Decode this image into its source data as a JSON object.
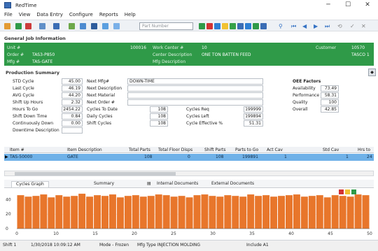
{
  "window": {
    "title": "RedTime"
  },
  "menu": [
    "File",
    "View",
    "Data Entry",
    "Configure",
    "Reports",
    "Help"
  ],
  "toolbar": {
    "part_placeholder": "Part Number"
  },
  "general": {
    "header": "General Job Information",
    "cells": [
      {
        "label": "Unit #",
        "value": "100016"
      },
      {
        "label": "Work Center #",
        "value": "10"
      },
      {
        "label": "Customer",
        "value": "10570"
      },
      {
        "label": "Order #",
        "value": "TAS3-P850"
      },
      {
        "label": "Center Description",
        "value": "ONE TON BATTEN FEED"
      },
      {
        "label": "",
        "value": "TASCO 1"
      },
      {
        "label": "Mfg #",
        "value": "TAS-GATE"
      },
      {
        "label": "Mfg Description",
        "value": ""
      }
    ]
  },
  "summary": {
    "header": "Production Summary",
    "left": [
      {
        "label": "STD Cycle",
        "value": "45.00"
      },
      {
        "label": "Last Cycle",
        "value": "46.19"
      },
      {
        "label": "AVG Cycle",
        "value": "44.20"
      },
      {
        "label": "Shift Up Hours",
        "value": "2.32"
      },
      {
        "label": "Hours To Go",
        "value": "2454.22"
      },
      {
        "label": "Shift Down Time",
        "value": "0.84"
      },
      {
        "label": "Continuously Down",
        "value": "0.00"
      },
      {
        "label": "Downtime Description",
        "value": ""
      }
    ],
    "next": [
      {
        "label": "Next Mfg#",
        "value": "DOWN-TIME"
      },
      {
        "label": "Next Description",
        "value": ""
      },
      {
        "label": "Next Material",
        "value": ""
      },
      {
        "label": "Next Order #",
        "value": ""
      }
    ],
    "cycles": [
      {
        "label": "Cycles To Date",
        "value": "108"
      },
      {
        "label": "Daily Cycles",
        "value": "108"
      },
      {
        "label": "Shift Cycles",
        "value": "108"
      }
    ],
    "req": [
      {
        "label": "Cycles Req",
        "value": "199999"
      },
      {
        "label": "Cycles Left",
        "value": "199894"
      },
      {
        "label": "Cycle Effective %",
        "value": "51.31"
      }
    ],
    "oee": {
      "header": "OEE Factors",
      "rows": [
        {
          "label": "Availability",
          "value": "73.49"
        },
        {
          "label": "Performance",
          "value": "58.31"
        },
        {
          "label": "Quality",
          "value": "100"
        },
        {
          "label": "Overall",
          "value": "42.85"
        }
      ]
    }
  },
  "grid": {
    "headers": [
      "Item #",
      "Item Description",
      "Total Parts",
      "Total Floor Disps",
      "Shift Parts",
      "Parts to Go",
      "Act Cav",
      "Std Cav",
      "Hrs to"
    ],
    "row": [
      "TAS-50000",
      "GATE",
      "108",
      "0",
      "108",
      "199891",
      "1",
      "1",
      "24"
    ]
  },
  "tabs": [
    "Cycles Graph",
    "Summary",
    "Internal Documents",
    "External Documents"
  ],
  "chart_data": {
    "type": "bar",
    "values": [
      46,
      44,
      45,
      47,
      43,
      46,
      44,
      45,
      48,
      44,
      46,
      45,
      47,
      43,
      45,
      46,
      44,
      45,
      47,
      46,
      44,
      45,
      43,
      46,
      47,
      45,
      44,
      46,
      45,
      44,
      47,
      45,
      46,
      44,
      45,
      46,
      47,
      44,
      45,
      46,
      43,
      46,
      45,
      44,
      47,
      46
    ],
    "ylim": [
      0,
      50
    ],
    "yticks": [
      "40",
      "20",
      "0"
    ],
    "xticks": [
      "0",
      "10",
      "15",
      "20",
      "25",
      "30",
      "35",
      "40",
      "45",
      "50"
    ],
    "bar_color": "#e8762b"
  },
  "status": {
    "shift": "Shift 1",
    "datetime": "1/30/2018 10:09:12 AM",
    "mode": "Mode - Frozen",
    "mfg_type": "Mfg Type INJECTION MOLDING",
    "include": "Include A1"
  }
}
